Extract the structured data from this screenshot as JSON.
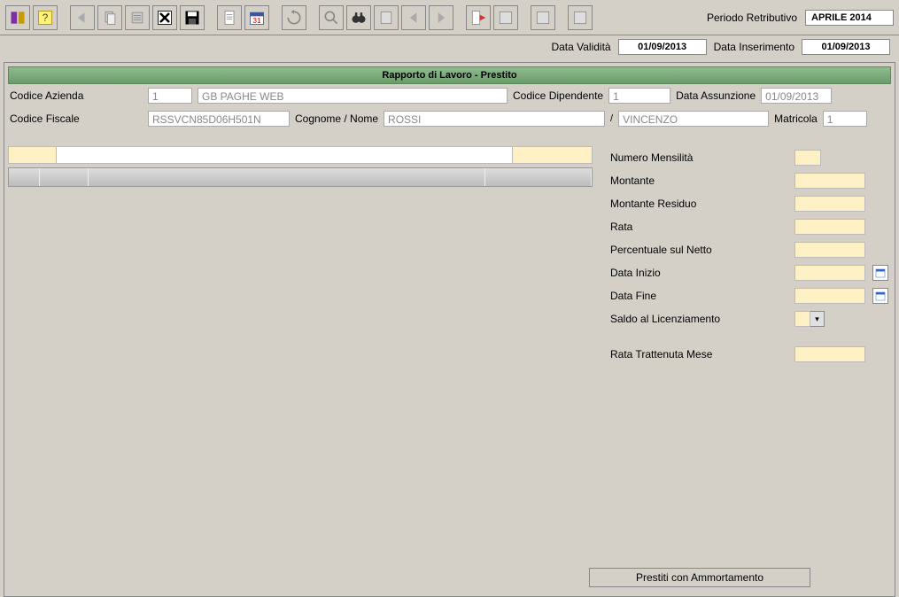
{
  "header": {
    "periodo_label": "Periodo Retributivo",
    "periodo_value": "APRILE 2014"
  },
  "validity": {
    "data_validita_label": "Data Validità",
    "data_validita_value": "01/09/2013",
    "data_inserimento_label": "Data Inserimento",
    "data_inserimento_value": "01/09/2013"
  },
  "section_title": "Rapporto di Lavoro - Prestito",
  "company": {
    "codice_azienda_label": "Codice Azienda",
    "codice_azienda_value": "1",
    "azienda_name": "GB PAGHE WEB",
    "codice_dipendente_label": "Codice Dipendente",
    "codice_dipendente_value": "1",
    "data_assunzione_label": "Data Assunzione",
    "data_assunzione_value": "01/09/2013"
  },
  "person": {
    "codice_fiscale_label": "Codice Fiscale",
    "codice_fiscale_value": "RSSVCN85D06H501N",
    "cognome_nome_label": "Cognome / Nome",
    "cognome_value": "ROSSI",
    "nome_sep": "/",
    "nome_value": "VINCENZO",
    "matricola_label": "Matricola",
    "matricola_value": "1"
  },
  "details": {
    "numero_mensilita_label": "Numero Mensilità",
    "numero_mensilita_value": "",
    "montante_label": "Montante",
    "montante_value": "",
    "montante_residuo_label": "Montante Residuo",
    "montante_residuo_value": "",
    "rata_label": "Rata",
    "rata_value": "",
    "percentuale_label": "Percentuale sul Netto",
    "percentuale_value": "",
    "data_inizio_label": "Data Inizio",
    "data_inizio_value": "",
    "data_fine_label": "Data Fine",
    "data_fine_value": "",
    "saldo_label": "Saldo al Licenziamento",
    "saldo_value": "",
    "rata_trattenuta_label": "Rata Trattenuta Mese",
    "rata_trattenuta_value": ""
  },
  "footer": {
    "prestiti_button": "Prestiti con Ammortamento"
  }
}
